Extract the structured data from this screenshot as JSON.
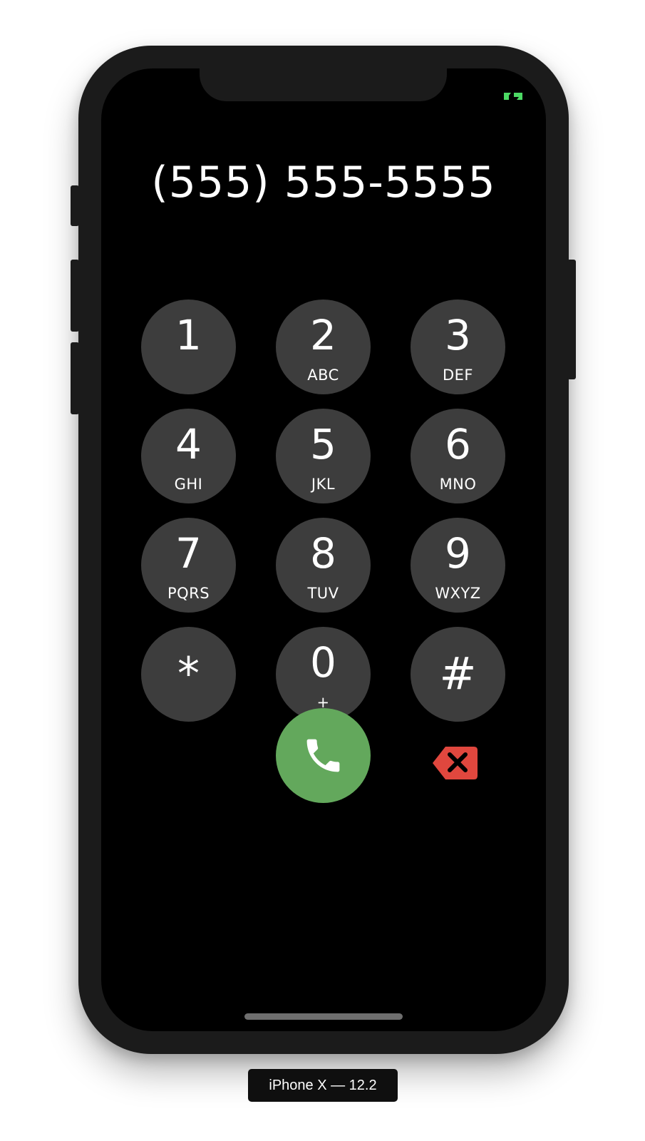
{
  "phone_number": "(555) 555-5555",
  "keypad": {
    "keys": [
      {
        "digit": "1",
        "letters": ""
      },
      {
        "digit": "2",
        "letters": "ABC"
      },
      {
        "digit": "3",
        "letters": "DEF"
      },
      {
        "digit": "4",
        "letters": "GHI"
      },
      {
        "digit": "5",
        "letters": "JKL"
      },
      {
        "digit": "6",
        "letters": "MNO"
      },
      {
        "digit": "7",
        "letters": "PQRS"
      },
      {
        "digit": "8",
        "letters": "TUV"
      },
      {
        "digit": "9",
        "letters": "WXYZ"
      },
      {
        "digit": "*",
        "letters": ""
      },
      {
        "digit": "0",
        "letters": "+"
      },
      {
        "digit": "#",
        "letters": ""
      }
    ]
  },
  "call_button": {
    "icon": "phone-icon",
    "color": "#63a85c"
  },
  "delete_button": {
    "icon": "delete-backspace-icon",
    "color": "#e0473e"
  },
  "status": {
    "icon": "status-glyph-icon",
    "color": "#4cd964"
  },
  "key_color": "#3d3d3d",
  "device_label": "iPhone X — 12.2"
}
